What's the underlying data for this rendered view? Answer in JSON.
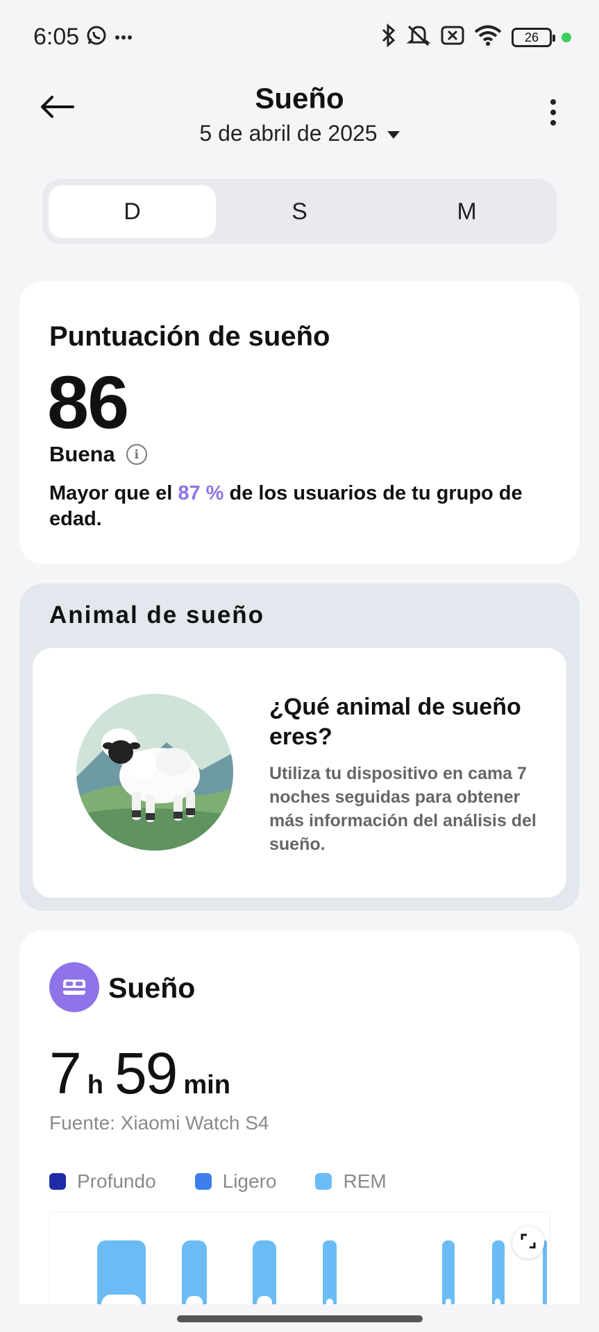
{
  "status_bar": {
    "time": "6:05",
    "battery": "26",
    "icons": [
      "whatsapp-icon",
      "more-notifications-icon",
      "bluetooth-icon",
      "mute-icon",
      "no-sim-icon",
      "wifi-icon",
      "battery-icon"
    ],
    "dot_color": "#3ccf5d"
  },
  "header": {
    "title": "Sueño",
    "date": "5 de abril de 2025"
  },
  "tabs": [
    {
      "label": "D",
      "active": true
    },
    {
      "label": "S",
      "active": false
    },
    {
      "label": "M",
      "active": false
    }
  ],
  "score": {
    "title": "Puntuación de sueño",
    "value": "86",
    "rating": "Buena",
    "desc_pre": "Mayor que el ",
    "percent": "87 %",
    "desc_post": " de los usuarios de tu grupo de edad."
  },
  "animal": {
    "title": "Animal de sueño",
    "question": "¿Qué animal de sueño eres?",
    "text": "Utiliza tu dispositivo en cama 7 noches seguidas para obtener más información del análisis del sueño."
  },
  "sleep": {
    "title": "Sueño",
    "hours": "7",
    "hours_unit": "h",
    "minutes": "59",
    "minutes_unit": "min",
    "source": "Fuente: Xiaomi Watch S4",
    "legend": [
      {
        "label": "Profundo",
        "color": "#1f2aa8"
      },
      {
        "label": "Ligero",
        "color": "#3d7eea"
      },
      {
        "label": "REM",
        "color": "#6bbcf5"
      }
    ],
    "accent": "#8f73e8"
  }
}
